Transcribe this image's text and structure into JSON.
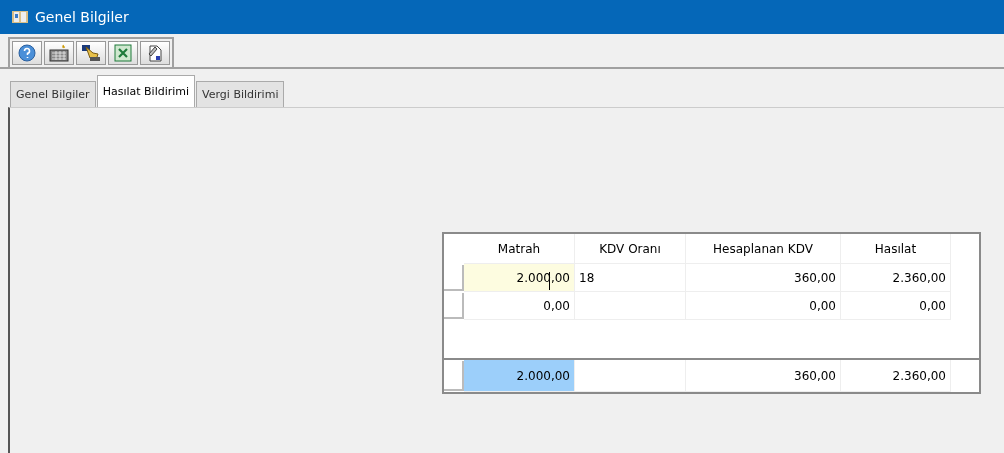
{
  "window": {
    "title": "Genel Bilgiler"
  },
  "toolbar": [
    {
      "kind": "help"
    },
    {
      "kind": "calculator"
    },
    {
      "kind": "wizard"
    },
    {
      "kind": "excel"
    },
    {
      "kind": "document"
    }
  ],
  "tabs": [
    {
      "label": "Genel Bilgiler",
      "selected": false
    },
    {
      "label": "Hasılat Bildirimi",
      "selected": true
    },
    {
      "label": "Vergi Bildirimi",
      "selected": false
    }
  ],
  "table": {
    "columns": [
      "Matrah",
      "KDV Oranı",
      "Hesaplanan KDV",
      "Hasılat"
    ],
    "rows": [
      {
        "kind": "data",
        "selected": true,
        "cells": [
          "2.000,00",
          "18",
          "360,00",
          "2.360,00"
        ]
      },
      {
        "kind": "data",
        "selected": false,
        "cells": [
          "0,00",
          "",
          "0,00",
          "0,00"
        ]
      },
      {
        "kind": "total",
        "selected": true,
        "cells": [
          "2.000,00",
          "",
          "360,00",
          "2.360,00"
        ]
      }
    ]
  }
}
